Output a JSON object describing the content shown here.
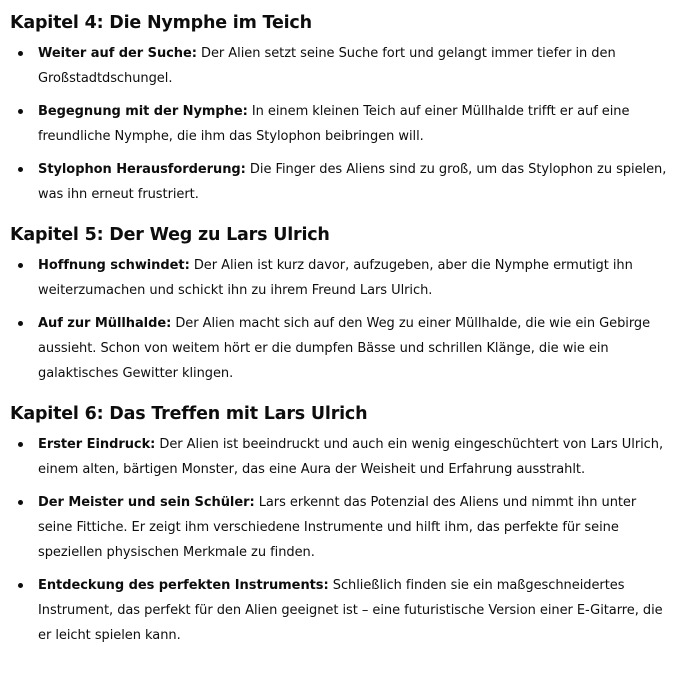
{
  "chapters": [
    {
      "title": "Kapitel 4: Die Nymphe im Teich",
      "items": [
        {
          "label": "Weiter auf der Suche:",
          "text": " Der Alien setzt seine Suche fort und gelangt immer tiefer in den Großstadtdschungel."
        },
        {
          "label": "Begegnung mit der Nymphe:",
          "text": " In einem kleinen Teich auf einer Müllhalde trifft er auf eine freundliche Nymphe, die ihm das Stylophon beibringen will."
        },
        {
          "label": "Stylophon Herausforderung:",
          "text": " Die Finger des Aliens sind zu groß, um das Stylophon zu spielen, was ihn erneut frustriert."
        }
      ]
    },
    {
      "title": "Kapitel 5: Der Weg zu Lars Ulrich",
      "items": [
        {
          "label": "Hoffnung schwindet:",
          "text": " Der Alien ist kurz davor, aufzugeben, aber die Nymphe ermutigt ihn weiterzumachen und schickt ihn zu ihrem Freund Lars Ulrich."
        },
        {
          "label": "Auf zur Müllhalde:",
          "text": " Der Alien macht sich auf den Weg zu einer Müllhalde, die wie ein Gebirge aussieht. Schon von weitem hört er die dumpfen Bässe und schrillen Klänge, die wie ein galaktisches Gewitter klingen."
        }
      ]
    },
    {
      "title": "Kapitel 6: Das Treffen mit Lars Ulrich",
      "items": [
        {
          "label": "Erster Eindruck:",
          "text": " Der Alien ist beeindruckt und auch ein wenig eingeschüchtert von Lars Ulrich, einem alten, bärtigen Monster, das eine Aura der Weisheit und Erfahrung ausstrahlt."
        },
        {
          "label": "Der Meister und sein Schüler:",
          "text": " Lars erkennt das Potenzial des Aliens und nimmt ihn unter seine Fittiche. Er zeigt ihm verschiedene Instrumente und hilft ihm, das perfekte für seine speziellen physischen Merkmale zu finden."
        },
        {
          "label": "Entdeckung des perfekten Instruments:",
          "text": " Schließlich finden sie ein maßgeschneidertes Instrument, das perfekt für den Alien geeignet ist – eine futuristische Version einer E-Gitarre, die er leicht spielen kann."
        }
      ]
    }
  ]
}
